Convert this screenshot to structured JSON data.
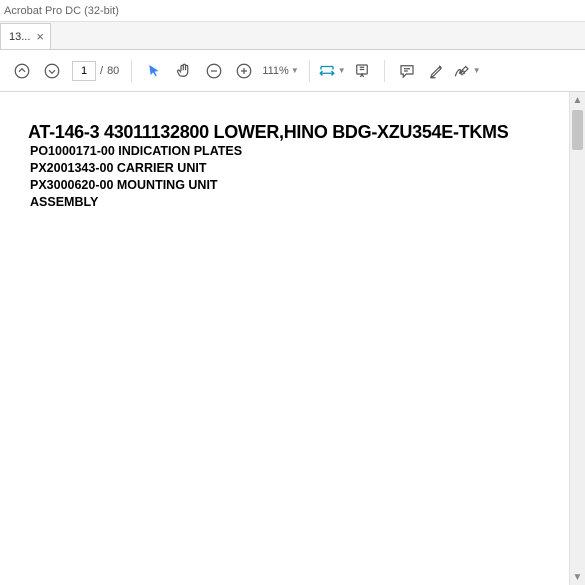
{
  "window": {
    "title": "Acrobat Pro DC (32-bit)"
  },
  "tab": {
    "label": "13...",
    "close": "×"
  },
  "toolbar": {
    "page_current": "1",
    "page_sep": "/",
    "page_total": "80",
    "zoom_level": "111%"
  },
  "document": {
    "heading": "AT-146-3 43011132800 LOWER,HINO BDG-XZU354E-TKMS",
    "lines": [
      "PO1000171-00 INDICATION PLATES",
      "PX2001343-00 CARRIER UNIT",
      "PX3000620-00 MOUNTING UNIT",
      "ASSEMBLY"
    ]
  }
}
